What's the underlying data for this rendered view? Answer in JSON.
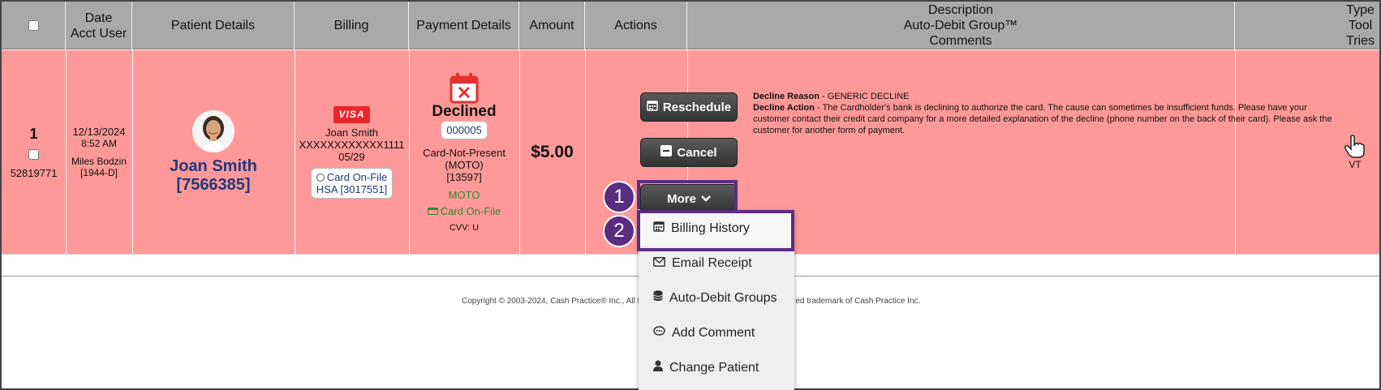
{
  "header": {
    "col_date": [
      "Date",
      "Acct User"
    ],
    "col_patient": "Patient Details",
    "col_billing": "Billing",
    "col_payment": "Payment Details",
    "col_amount": "Amount",
    "col_actions": "Actions",
    "col_desc": [
      "Description",
      "Auto-Debit Group™",
      "Comments"
    ],
    "col_type": [
      "Type",
      "Tool",
      "Tries"
    ]
  },
  "row": {
    "index": "1",
    "id": "52819771",
    "date": "12/13/2024",
    "time": "8:52 AM",
    "user": "Miles Bodzin",
    "user_code": "[1944-D]",
    "patient_name": "Joan Smith [7566385]",
    "billing": {
      "card_brand": "VISA",
      "name": "Joan Smith",
      "card_number": "XXXXXXXXXXXX1111",
      "expiry": "05/29",
      "cof_label": "Card On-File",
      "hsa_label": "HSA [3017551]"
    },
    "payment": {
      "status": "Declined",
      "code": "000005",
      "method_lines": [
        "Card-Not-Present",
        "(MOTO)",
        "[13597]"
      ],
      "moto": "MOTO",
      "cof": "Card On-File",
      "cvv": "CVV: U"
    },
    "amount": "$5.00",
    "actions": {
      "reschedule": "Reschedule",
      "cancel": "Cancel",
      "more": "More"
    },
    "description": {
      "reason_label": "Decline Reason",
      "reason_value": " - GENERIC DECLINE",
      "action_label": "Decline Action",
      "action_value": " - The Cardholder's bank is declining to authorize the card. The cause can sometimes be insufficient funds. Please have your customer contact their credit card company for a more detailed explanation of the decline (phone number on the back of their card). Please ask the customer for another form of payment."
    },
    "type": "VT"
  },
  "menu": {
    "billing_history": "Billing History",
    "email_receipt": "Email Receipt",
    "auto_debit_groups": "Auto-Debit Groups",
    "add_comment": "Add Comment",
    "change_patient": "Change Patient"
  },
  "callouts": {
    "one": "1",
    "two": "2"
  },
  "footer": {
    "left": "Copyright © 2003-2024, Cash Practice® Inc., All R",
    "right": "red trademark of Cash Practice Inc."
  },
  "colors": {
    "row_bg": "#ff9999",
    "header_bg": "#a9a9a9",
    "accent": "#5a2d82",
    "patient_link": "#1f3a7a",
    "moto_green": "#2e8b2e",
    "declined_red": "#e53030"
  }
}
